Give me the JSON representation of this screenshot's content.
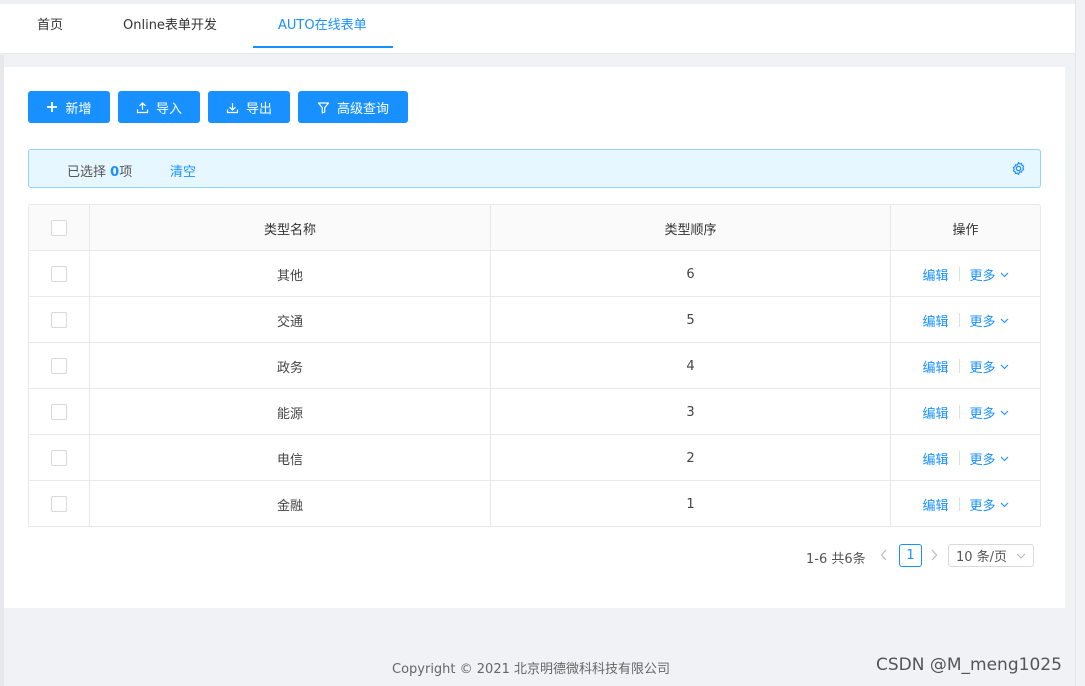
{
  "tabs": [
    {
      "label": "首页"
    },
    {
      "label": "Online表单开发"
    },
    {
      "label": "AUTO在线表单"
    }
  ],
  "toolbar": {
    "add_label": "新增",
    "import_label": "导入",
    "export_label": "导出",
    "query_label": "高级查询"
  },
  "selection": {
    "prefix": "已选择 ",
    "count": "0",
    "suffix": "项",
    "clear_label": "清空"
  },
  "table": {
    "columns": [
      "类型名称",
      "类型顺序",
      "操作"
    ],
    "rows": [
      {
        "name": "其他",
        "order": "6"
      },
      {
        "name": "交通",
        "order": "5"
      },
      {
        "name": "政务",
        "order": "4"
      },
      {
        "name": "能源",
        "order": "3"
      },
      {
        "name": "电信",
        "order": "2"
      },
      {
        "name": "金融",
        "order": "1"
      }
    ],
    "edit_label": "编辑",
    "more_label": "更多"
  },
  "pagination": {
    "total_text": "1-6 共6条",
    "current_page": "1",
    "page_size": "10 条/页"
  },
  "footer": {
    "copyright": "Copyright © 2021 北京明德微科科技有限公司",
    "watermark": "CSDN @M_meng1025"
  },
  "colors": {
    "primary": "#1890ff",
    "alert_bg": "#e6f7ff",
    "alert_border": "#91d5ff",
    "page_bg": "#f0f2f5"
  }
}
